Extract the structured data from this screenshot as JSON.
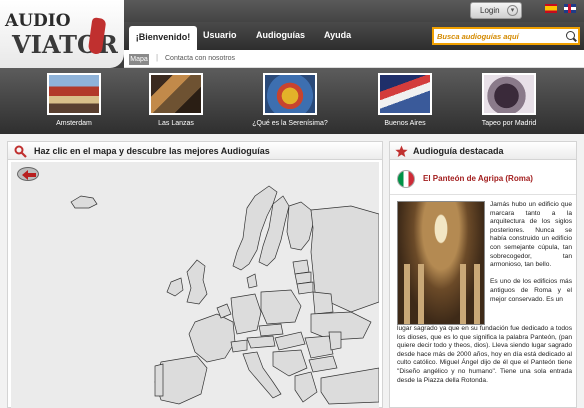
{
  "logo": {
    "line1": "AUDIO",
    "line2": "VIATOR"
  },
  "topbar": {
    "login_label": "Login",
    "languages": [
      "es",
      "en"
    ]
  },
  "nav": {
    "active": "¡Bienvenido!",
    "items": [
      "Usuario",
      "Audioguías",
      "Ayuda"
    ]
  },
  "search": {
    "placeholder": "Busca audioguías aquí"
  },
  "subnav": {
    "mapa": "Mapa",
    "separator": "|",
    "contacto": "Contacta con nosotros"
  },
  "featured": [
    {
      "label": "Amsterdam",
      "icon": "amsterdam-thumbnail"
    },
    {
      "label": "Las Lanzas",
      "icon": "las-lanzas-thumbnail"
    },
    {
      "label": "¿Qué es la Serenísima?",
      "icon": "serenisima-thumbnail"
    },
    {
      "label": "Buenos Aires",
      "icon": "buenos-aires-thumbnail"
    },
    {
      "label": "Tapeo por Madrid",
      "icon": "tapeo-madrid-thumbnail"
    }
  ],
  "map_panel": {
    "title": "Haz clic en el mapa y descubre las mejores Audioguías"
  },
  "feature_panel": {
    "title": "Audioguía destacada",
    "guide_name": "El Panteón de Agripa (Roma)",
    "para_right": "Jamás hubo un edificio que marcara tanto a la arquitectura de los siglos posteriores. Nunca se había construido un edificio con semejante cúpula, tan sobrecogedor, tan armonioso, tan bello.",
    "para_right2": "Es uno de los edificios más antiguos de Roma y el mejor conservado. Es un",
    "para_full": "lugar sagrado ya que en su fundación fue dedicado a todos los dioses, que es lo que significa la palabra Panteón, (pan quiere decir todo y theos, dios). Lleva siendo lugar sagrado desde hace más de 2000 años, hoy en día está dedicado al culto católico. Miguel Ángel dijo de él que el Panteón tiene \"Diseño angélico y no humano\". Tiene una sola entrada desde la Piazza della Rotonda."
  },
  "colors": {
    "accent": "#f0a000",
    "brand_red": "#a31f1f",
    "header_dark": "#3e3e3e"
  }
}
